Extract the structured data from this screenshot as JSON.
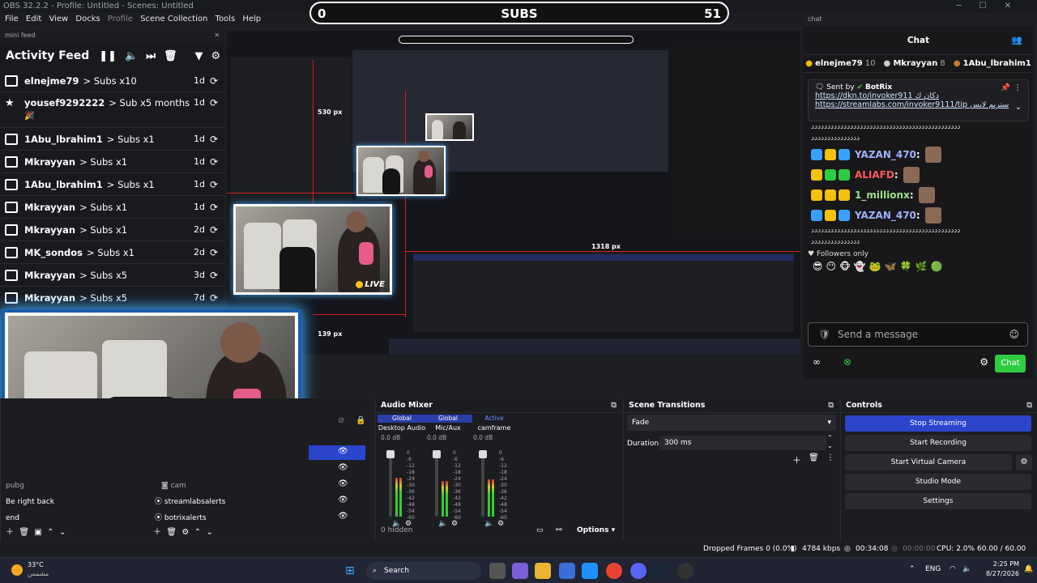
{
  "window": {
    "title": "OBS 32.2.2 - Profile: Untitled - Scenes: Untitled"
  },
  "menu": [
    "File",
    "Edit",
    "View",
    "Docks",
    "Profile",
    "Scene Collection",
    "Tools",
    "Help"
  ],
  "subs_bar": {
    "left": "0",
    "label": "SUBS",
    "right": "51"
  },
  "mini_feed": {
    "dock_label": "mini feed",
    "title": "Activity Feed",
    "items": [
      {
        "name": "elnejme79",
        "desc": "> Subs x10",
        "ago": "1d",
        "icon": "gift-icon"
      },
      {
        "name": "yousef9292222",
        "desc": "> Sub x5 months",
        "ago": "1d",
        "icon": "star-icon",
        "extra": "🎉"
      },
      {
        "name": "1Abu_lbrahim1",
        "desc": "> Subs x1",
        "ago": "1d",
        "icon": "gift-icon"
      },
      {
        "name": "Mkrayyan",
        "desc": "> Subs x1",
        "ago": "1d",
        "icon": "gift-icon"
      },
      {
        "name": "1Abu_lbrahim1",
        "desc": "> Subs x1",
        "ago": "1d",
        "icon": "gift-icon"
      },
      {
        "name": "Mkrayyan",
        "desc": "> Subs x1",
        "ago": "1d",
        "icon": "gift-icon"
      },
      {
        "name": "Mkrayyan",
        "desc": "> Subs x1",
        "ago": "2d",
        "icon": "gift-icon"
      },
      {
        "name": "MK_sondos",
        "desc": "> Subs x1",
        "ago": "2d",
        "icon": "gift-icon"
      },
      {
        "name": "Mkrayyan",
        "desc": "> Subs x5",
        "ago": "3d",
        "icon": "gift-icon"
      },
      {
        "name": "Mkrayyan",
        "desc": "> Subs x5",
        "ago": "7d",
        "icon": "gift-icon"
      }
    ]
  },
  "preview": {
    "labels": {
      "w1": "530 px",
      "w2": "1318 px",
      "h": "139 px"
    },
    "live": "LIVE"
  },
  "chat": {
    "dock_label": "chat",
    "title": "Chat",
    "leaders": [
      {
        "name": "elnejme79",
        "count": "10"
      },
      {
        "name": "Mkrayyan",
        "count": "8"
      },
      {
        "name": "1Abu_lbrahim1",
        "count": ""
      }
    ],
    "pinned": {
      "sent_by": "Sent by",
      "bot": "BotRix",
      "link1": "https://dkn.to/invoker911",
      "link1_suffix": "دكان ك",
      "link2": "https://streamlabs.com/invoker9111/tip",
      "link2_suffix": "ستريم لابس"
    },
    "spam": "دددددددددددددددددددددددددددددددددددددددددددددد",
    "spam_short": "ددددددددددددددد",
    "messages": [
      {
        "user": "YAZAN_470",
        "color": "#9fb3ff"
      },
      {
        "user": "ALIAFD",
        "color": "#ff5a5a"
      },
      {
        "user": "1_millionx",
        "color": "#9fe08a"
      },
      {
        "user": "YAZAN_470",
        "color": "#9fb3ff"
      }
    ],
    "followers_only": "Followers only",
    "placeholder": "Send a message",
    "chat_button": "Chat"
  },
  "sources": {
    "items": [
      "pubg",
      "Be right back",
      "end"
    ],
    "sub_items": [
      "cam",
      "streamlabsalerts",
      "botrixalerts"
    ]
  },
  "audio_mixer": {
    "title": "Audio Mixer",
    "channels": [
      {
        "head": "Global",
        "name": "Desktop Audio",
        "db": "0.0 dB",
        "level": 0.6
      },
      {
        "head": "Global",
        "name": "Mic/Aux",
        "db": "0.0 dB",
        "level": 0.55
      },
      {
        "head": "Active",
        "name": "camframe",
        "db": "0.0 dB",
        "level": 0.58
      }
    ],
    "ticks": [
      "0",
      "-6",
      "-12",
      "-18",
      "-24",
      "-30",
      "-36",
      "-42",
      "-48",
      "-54",
      "-60"
    ],
    "hidden": "0 hidden",
    "options": "Options"
  },
  "scene_transitions": {
    "title": "Scene Transitions",
    "transition": "Fade",
    "duration_label": "Duration",
    "duration": "300 ms"
  },
  "controls": {
    "title": "Controls",
    "buttons": [
      "Stop Streaming",
      "Start Recording",
      "Start Virtual Camera",
      "Studio Mode",
      "Settings"
    ]
  },
  "status": {
    "dropped": "Dropped Frames 0 (0.0%)",
    "kbps": "4784 kbps",
    "live_time": "00:34:08",
    "rec_time": "00:00:00",
    "cpu": "CPU: 2.0%",
    "fps": "60.00 / 60.00 FPS"
  },
  "taskbar": {
    "temp": "33°C",
    "weather": "مشمس",
    "search": "Search",
    "lang": "ENG",
    "time": "2:25 PM",
    "date": "8/27/2026"
  },
  "colors": {
    "accent": "#2b45cc",
    "chat_button": "#2ecc40",
    "redline": "#d02020",
    "frame_glow": "#3fa9ff"
  }
}
